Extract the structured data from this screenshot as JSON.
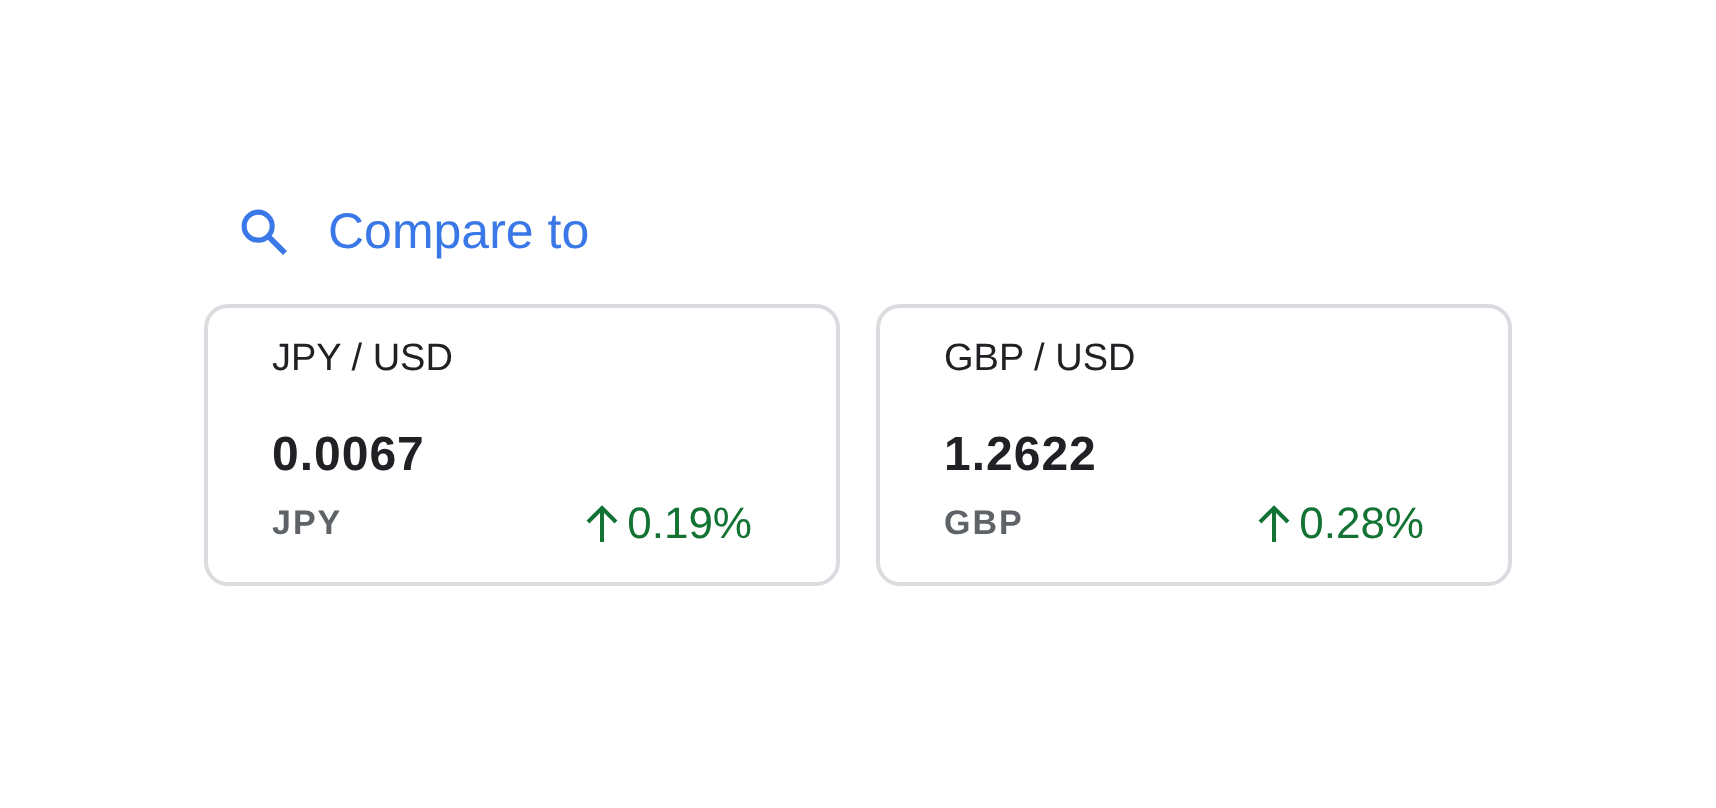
{
  "compare": {
    "label": "Compare to"
  },
  "cards": [
    {
      "pair": "JPY / USD",
      "value": "0.0067",
      "currency": "JPY",
      "change": "0.19%",
      "kind": "up"
    },
    {
      "pair": "GBP / USD",
      "value": "1.2622",
      "currency": "GBP",
      "change": "0.28%",
      "kind": "up"
    }
  ]
}
